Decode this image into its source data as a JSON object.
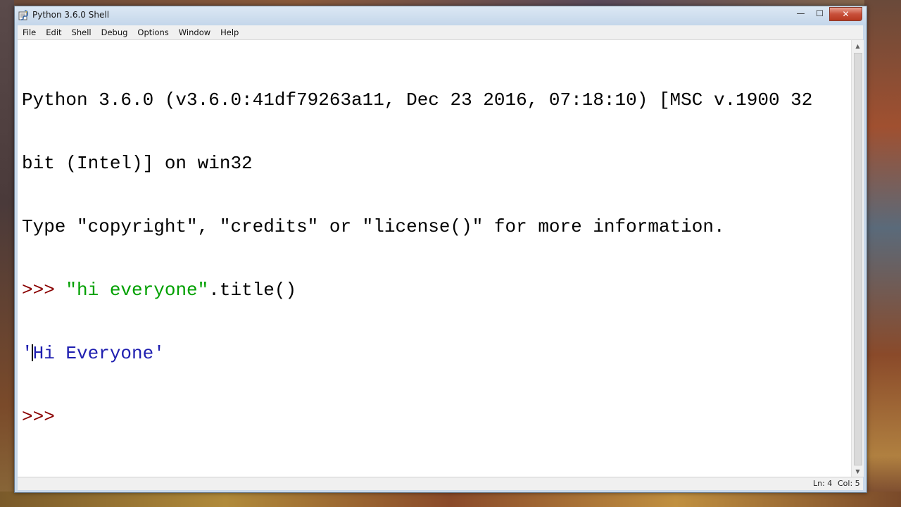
{
  "window": {
    "title": "Python 3.6.0 Shell",
    "controls": {
      "minimize": "—",
      "maximize": "☐",
      "close": "✕"
    }
  },
  "menu": {
    "items": [
      {
        "label": "File"
      },
      {
        "label": "Edit"
      },
      {
        "label": "Shell"
      },
      {
        "label": "Debug"
      },
      {
        "label": "Options"
      },
      {
        "label": "Window"
      },
      {
        "label": "Help"
      }
    ]
  },
  "shell": {
    "banner_line1": "Python 3.6.0 (v3.6.0:41df79263a11, Dec 23 2016, 07:18:10) [MSC v.1900 32",
    "banner_line2": "bit (Intel)] on win32",
    "banner_line3": "Type \"copyright\", \"credits\" or \"license()\" for more information.",
    "prompt": ">>> ",
    "command_string": "\"hi everyone\"",
    "command_method": ".title()",
    "output_open": "'",
    "output_text": "Hi Everyone'",
    "final_prompt": ">>> "
  },
  "status": {
    "line": "Ln: 4",
    "col": "Col: 5"
  },
  "icons": {
    "app": "python-idle-icon",
    "scroll_up": "arrow-up-icon",
    "scroll_down": "arrow-down-icon"
  }
}
